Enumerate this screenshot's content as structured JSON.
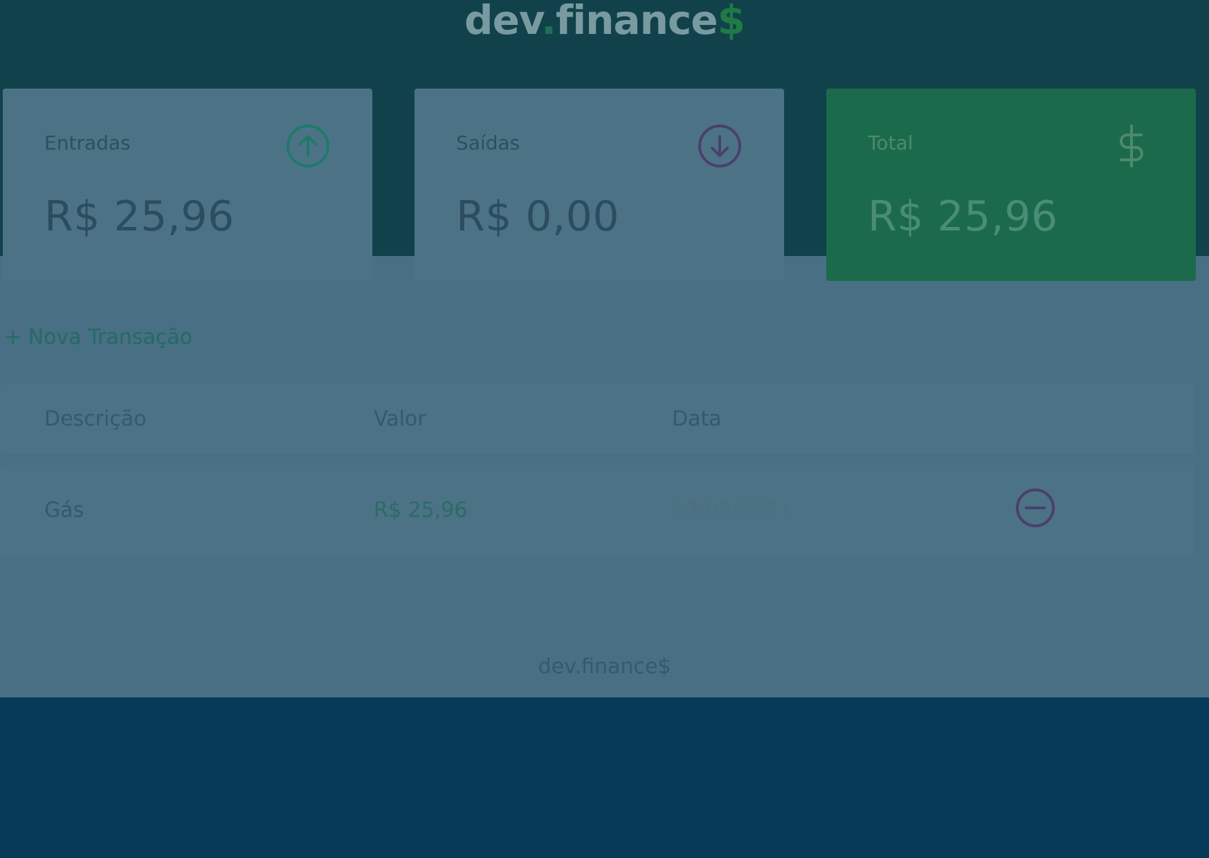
{
  "header": {
    "logo_main": "dev",
    "logo_dot": ".",
    "logo_rest": "finance",
    "logo_dollar": "$"
  },
  "cards": {
    "income": {
      "label": "Entradas",
      "value": "R$ 25,96",
      "icon": "arrow-up-circle-icon"
    },
    "expense": {
      "label": "Saídas",
      "value": "R$ 0,00",
      "icon": "arrow-down-circle-icon"
    },
    "total": {
      "label": "Total",
      "value": "R$ 25,96",
      "icon": "dollar-icon"
    }
  },
  "actions": {
    "new_transaction": "+ Nova Transação"
  },
  "table": {
    "headers": [
      "Descrição",
      "Valor",
      "Data"
    ],
    "rows": [
      {
        "description": "Gás",
        "amount": "R$ 25,96",
        "date": "03/03/2021",
        "action_icon": "minus-circle-icon"
      }
    ]
  },
  "footer": {
    "text": "dev.finance$"
  },
  "colors": {
    "income_accent": "#1f7a6a",
    "expense_accent": "#4a3f6e",
    "total_bg": "#1b6a4c"
  }
}
